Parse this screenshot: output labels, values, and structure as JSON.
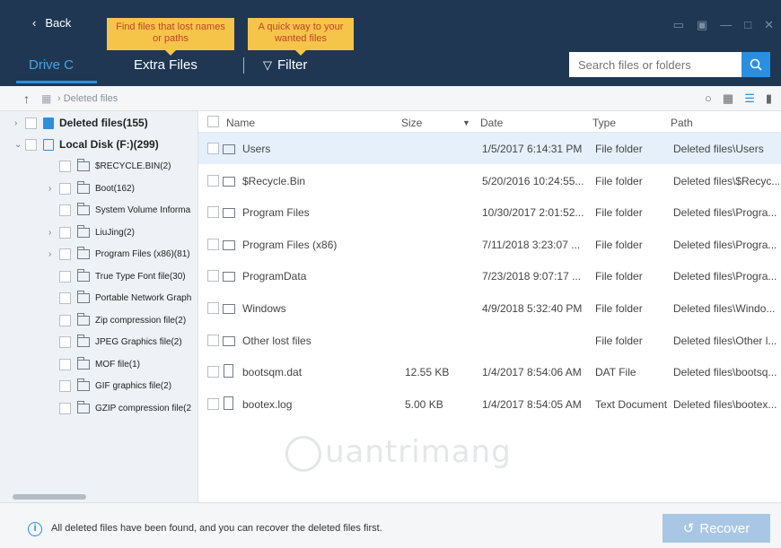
{
  "header": {
    "back_label": "Back",
    "tooltip_lost_names": "Find files that lost names or paths",
    "tooltip_quick_way": "A quick way to your wanted files",
    "tabs": [
      "Drive C",
      "Extra Files",
      "Filter"
    ],
    "search_placeholder": "Search files or folders"
  },
  "toolbar": {
    "breadcrumb": "Deleted files"
  },
  "sidebar": {
    "deleted_files": "Deleted files(155)",
    "local_disk": "Local Disk (F:)(299)",
    "items": [
      "$RECYCLE.BIN(2)",
      "Boot(162)",
      "System Volume Informa",
      "LiuJing(2)",
      "Program Files (x86)(81)",
      "True Type Font file(30)",
      "Portable Network Graph",
      "Zip compression file(2)",
      "JPEG Graphics file(2)",
      "MOF file(1)",
      "GIF graphics file(2)",
      "GZIP compression file(2"
    ]
  },
  "table": {
    "columns": [
      "Name",
      "Size",
      "Date",
      "Type",
      "Path"
    ],
    "rows": [
      {
        "name": "Users",
        "size": "",
        "date": "1/5/2017 6:14:31 PM",
        "type": "File folder",
        "path": "Deleted files\\Users"
      },
      {
        "name": "$Recycle.Bin",
        "size": "",
        "date": "5/20/2016 10:24:55...",
        "type": "File folder",
        "path": "Deleted files\\$Recyc..."
      },
      {
        "name": "Program Files",
        "size": "",
        "date": "10/30/2017 2:01:52...",
        "type": "File folder",
        "path": "Deleted files\\Progra..."
      },
      {
        "name": "Program Files (x86)",
        "size": "",
        "date": "7/11/2018 3:23:07 ...",
        "type": "File folder",
        "path": "Deleted files\\Progra..."
      },
      {
        "name": "ProgramData",
        "size": "",
        "date": "7/23/2018 9:07:17 ...",
        "type": "File folder",
        "path": "Deleted files\\Progra..."
      },
      {
        "name": "Windows",
        "size": "",
        "date": "4/9/2018 5:32:40 PM",
        "type": "File folder",
        "path": "Deleted files\\Windo..."
      },
      {
        "name": "Other lost files",
        "size": "",
        "date": "",
        "type": "File folder",
        "path": "Deleted files\\Other l..."
      },
      {
        "name": "bootsqm.dat",
        "size": "12.55 KB",
        "date": "1/4/2017 8:54:06 AM",
        "type": "DAT File",
        "path": "Deleted files\\bootsq..."
      },
      {
        "name": "bootex.log",
        "size": "5.00 KB",
        "date": "1/4/2017 8:54:05 AM",
        "type": "Text Document",
        "path": "Deleted files\\bootex..."
      }
    ]
  },
  "footer": {
    "message": "All deleted files have been found, and you can recover the deleted files first.",
    "recover_label": "Recover"
  },
  "colors": {
    "header_bg": "#1f3752",
    "accent": "#2b8fe0",
    "tooltip_bg": "#f5c54a"
  }
}
